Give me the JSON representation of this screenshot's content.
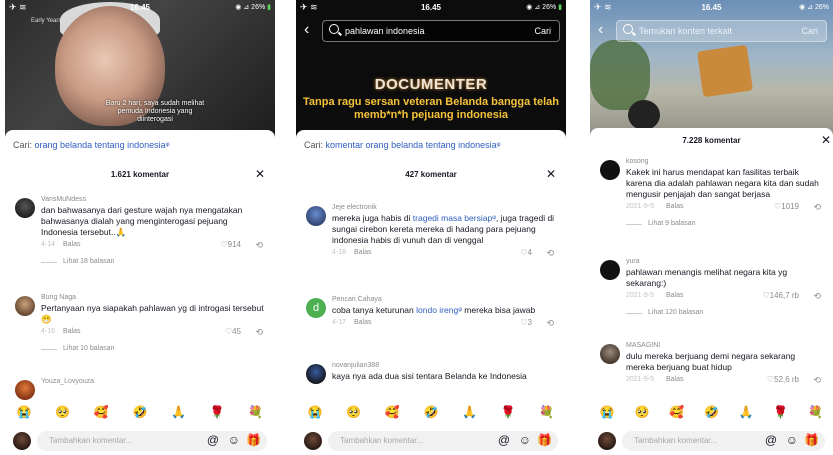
{
  "status_bar": {
    "time": "16.45",
    "battery": "26%"
  },
  "panels": [
    {
      "subtitle": "Baru 2 hari, saya sudah melihat pemuda Indonesia yang diinterogasi",
      "channel": "Early Years",
      "search": {
        "label": "Cari:",
        "query": "orang belanda tentang indonesia"
      },
      "comment_count": "1.621 komentar",
      "comments": [
        {
          "user": "VansMuNdess",
          "text": "dan bahwasanya dari gesture wajah nya mengatakan bahwasanya dialah yang menginterogasi pejuang Indonesia tersebut..🙏",
          "date": "4-14",
          "reply": "Balas",
          "likes": "914",
          "views": "Lihat 18 balasan"
        },
        {
          "user": "Bung Naga",
          "text": "Pertanyaan nya siapakah pahlawan yg di introgasi tersebut 😁",
          "date": "4-16",
          "reply": "Balas",
          "likes": "45",
          "views": "Lihat 10 balasan"
        },
        {
          "user": "Youza_Lovyouza",
          "text": "",
          "date": "",
          "reply": "",
          "likes": "",
          "views": ""
        }
      ]
    },
    {
      "search_box": {
        "query": "pahlawan indonesia",
        "button": "Cari"
      },
      "title": "DOCUMENTER",
      "headline": "Tanpa ragu sersan veteran Belanda bangga telah memb*n*h pejuang indonesia",
      "search": {
        "label": "Cari:",
        "query": "komentar orang belanda tentang indonesia"
      },
      "comment_count": "427 komentar",
      "comments": [
        {
          "user": "Jeje electronik",
          "text_before": "mereka juga habis di ",
          "link": "tragedi masa bersiap",
          "text_after": ", juga tragedi di sungai cirebon kereta mereka di hadang para pejuang indonesia habis di vunuh dan di venggal",
          "date": "4-18",
          "reply": "Balas",
          "likes": "4"
        },
        {
          "user": "Pencari Cahaya",
          "text_before": "coba tanya keturunan ",
          "link": "londo ireng",
          "text_after": " mereka bisa jawab",
          "date": "4-17",
          "reply": "Balas",
          "likes": "3"
        },
        {
          "user": "novanjulian388",
          "text_before": "kaya nya ada dua sisi tentara Belanda ke Indonesia",
          "link": "",
          "text_after": "",
          "date": "",
          "reply": "",
          "likes": ""
        }
      ]
    },
    {
      "search_box": {
        "query": "Temukan konten terkait",
        "button": "Cari"
      },
      "comment_count": "7.228 komentar",
      "comments": [
        {
          "user": "kosong",
          "text": "Kakek ini harus mendapat kan fasilitas terbaik karena dia adalah pahlawan negara kita dan sudah mengusir penjajah dan sangat berjasa",
          "date": "2021-9-5",
          "reply": "Balas",
          "likes": "1019",
          "views": "Lihat 9 balasan"
        },
        {
          "user": "yura",
          "text": "pahlawan menangis melihat negara kita yg sekarang:)",
          "date": "2021-9-5",
          "reply": "Balas",
          "likes": "146,7 rb",
          "views": "Lihat 120 balasan"
        },
        {
          "user": "MASAGINI",
          "text": "dulu mereka berjuang demi negara sekarang mereka berjuang buat hidup",
          "date": "2021-9-5",
          "reply": "Balas",
          "likes": "52,6 rb",
          "views": ""
        }
      ]
    }
  ],
  "emojis": [
    "😭",
    "🥺",
    "🥰",
    "🤣",
    "🙏",
    "🌹",
    "💐"
  ],
  "input": {
    "placeholder": "Tambahkan komentar...",
    "icons": [
      "@",
      "☺",
      "🎁"
    ]
  },
  "colors": {
    "link": "#2f5fbf",
    "battery": "#5cd65c"
  }
}
